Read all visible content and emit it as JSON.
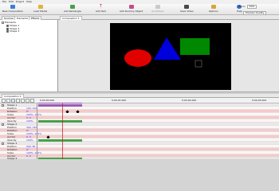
{
  "menubar": {
    "items": [
      "File",
      "Edit",
      "Project",
      "Help"
    ]
  },
  "toolbar": {
    "buttons": [
      {
        "label": "New Composition"
      },
      {
        "label": "Load Media"
      },
      {
        "label": "Add Rectangle"
      },
      {
        "label": "Add Text"
      },
      {
        "label": "Add Dummy Object"
      },
      {
        "label": "Undefined"
      },
      {
        "label": "Save Video"
      },
      {
        "label": "Options"
      },
      {
        "label": "Help"
      }
    ],
    "zoom_label": "Zoom",
    "zoom_value": "50%",
    "preview_quality_label": "Preview Quality"
  },
  "tabs": {
    "left": [
      "Sources",
      "Elements",
      "Effects"
    ],
    "stage": "Composition 1"
  },
  "tree": {
    "root": "Elements",
    "children": [
      "Shape 1",
      "Shape 2",
      "Shape 3"
    ]
  },
  "timeline": {
    "tab": "Composition 1",
    "time_start": "0:00:00.000",
    "time_marks": [
      "0:00:01.000",
      "0:00:02.000",
      "0:00:03.000"
    ],
    "groups": [
      {
        "name": "Shape 1",
        "rows": [
          {
            "label": "Position",
            "value": "100, 100"
          },
          {
            "label": "Rotation",
            "value": "0°"
          },
          {
            "label": "Scale",
            "value": "100%, 100%"
          },
          {
            "label": "Anchor",
            "value": "0, 0"
          },
          {
            "label": "Opacity",
            "value": "100%"
          }
        ]
      },
      {
        "name": "Shape 2",
        "rows": [
          {
            "label": "Position",
            "value": "300, 120"
          },
          {
            "label": "Rotation",
            "value": "0°"
          },
          {
            "label": "Scale",
            "value": "100%, 100%"
          },
          {
            "label": "Anchor",
            "value": "0, 0"
          },
          {
            "label": "Opacity",
            "value": "100%"
          }
        ]
      },
      {
        "name": "Shape 3",
        "rows": [
          {
            "label": "Position",
            "value": "500, 80"
          },
          {
            "label": "Rotation",
            "value": "0°"
          },
          {
            "label": "Scale",
            "value": "100%, 100%"
          },
          {
            "label": "Anchor",
            "value": "0, 0"
          },
          {
            "label": "Opacity",
            "value": "100%"
          }
        ]
      },
      {
        "name": "Shape 4",
        "rows": []
      }
    ]
  },
  "colors": {
    "accent_green": "#49a049",
    "keyframe_band": "#f6caca",
    "stage_red": "#e00000",
    "stage_blue": "#0000dd",
    "stage_green": "#008800"
  }
}
